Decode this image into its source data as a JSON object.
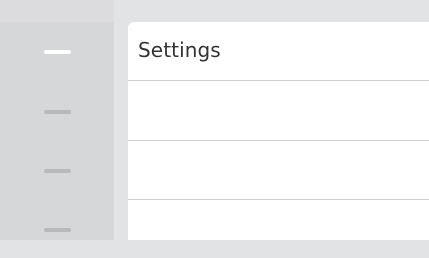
{
  "settings": {
    "title": "Settings"
  },
  "sidebar": {
    "items": [
      {
        "name": "nav-item-1",
        "active": true
      },
      {
        "name": "nav-item-2",
        "active": false
      },
      {
        "name": "nav-item-3",
        "active": false
      },
      {
        "name": "nav-item-4",
        "active": false
      }
    ]
  },
  "colors": {
    "background": "#e2e3e5",
    "sidebar": "#d6d7d9",
    "panel": "#ffffff",
    "divider": "#cfd0d3",
    "active_indicator": "#ffffff",
    "inactive_indicator": "#b9b9bc",
    "title_text": "#333333"
  }
}
